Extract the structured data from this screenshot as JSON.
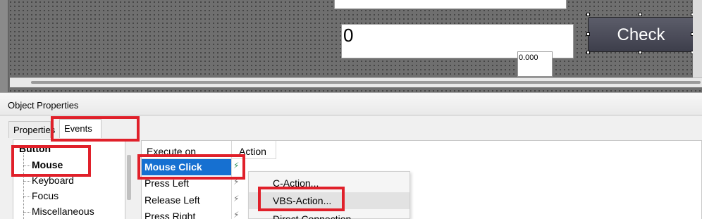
{
  "canvas": {
    "io_value": "0",
    "io_small_value": "0.000",
    "check_button_label": "Check"
  },
  "panel": {
    "title": "Object Properties",
    "tabs": [
      {
        "label": "Properties",
        "active": false
      },
      {
        "label": "Events",
        "active": true
      }
    ],
    "tree": {
      "root": "Button",
      "items": [
        "Mouse",
        "Keyboard",
        "Focus",
        "Miscellaneous"
      ],
      "selected": "Mouse"
    },
    "grid": {
      "headers": {
        "execute_on": "Execute on",
        "action": "Action"
      },
      "rows": [
        {
          "label": "Mouse Click",
          "selected": true,
          "action_icon": "vbs-bolt-icon"
        },
        {
          "label": "Press Left",
          "selected": false,
          "action_icon": "bolt-icon"
        },
        {
          "label": "Release Left",
          "selected": false,
          "action_icon": "bolt-icon"
        },
        {
          "label": "Press Right",
          "selected": false,
          "action_icon": "bolt-icon"
        }
      ]
    },
    "context_menu": {
      "items": [
        {
          "label": "C-Action...",
          "hover": false
        },
        {
          "label": "VBS-Action...",
          "hover": true
        },
        {
          "label": "Direct Connection",
          "hover": false
        }
      ]
    }
  },
  "colors": {
    "selection_blue": "#1670d1",
    "highlight_red": "#e0202a",
    "button_dark": "#4a4b58"
  }
}
